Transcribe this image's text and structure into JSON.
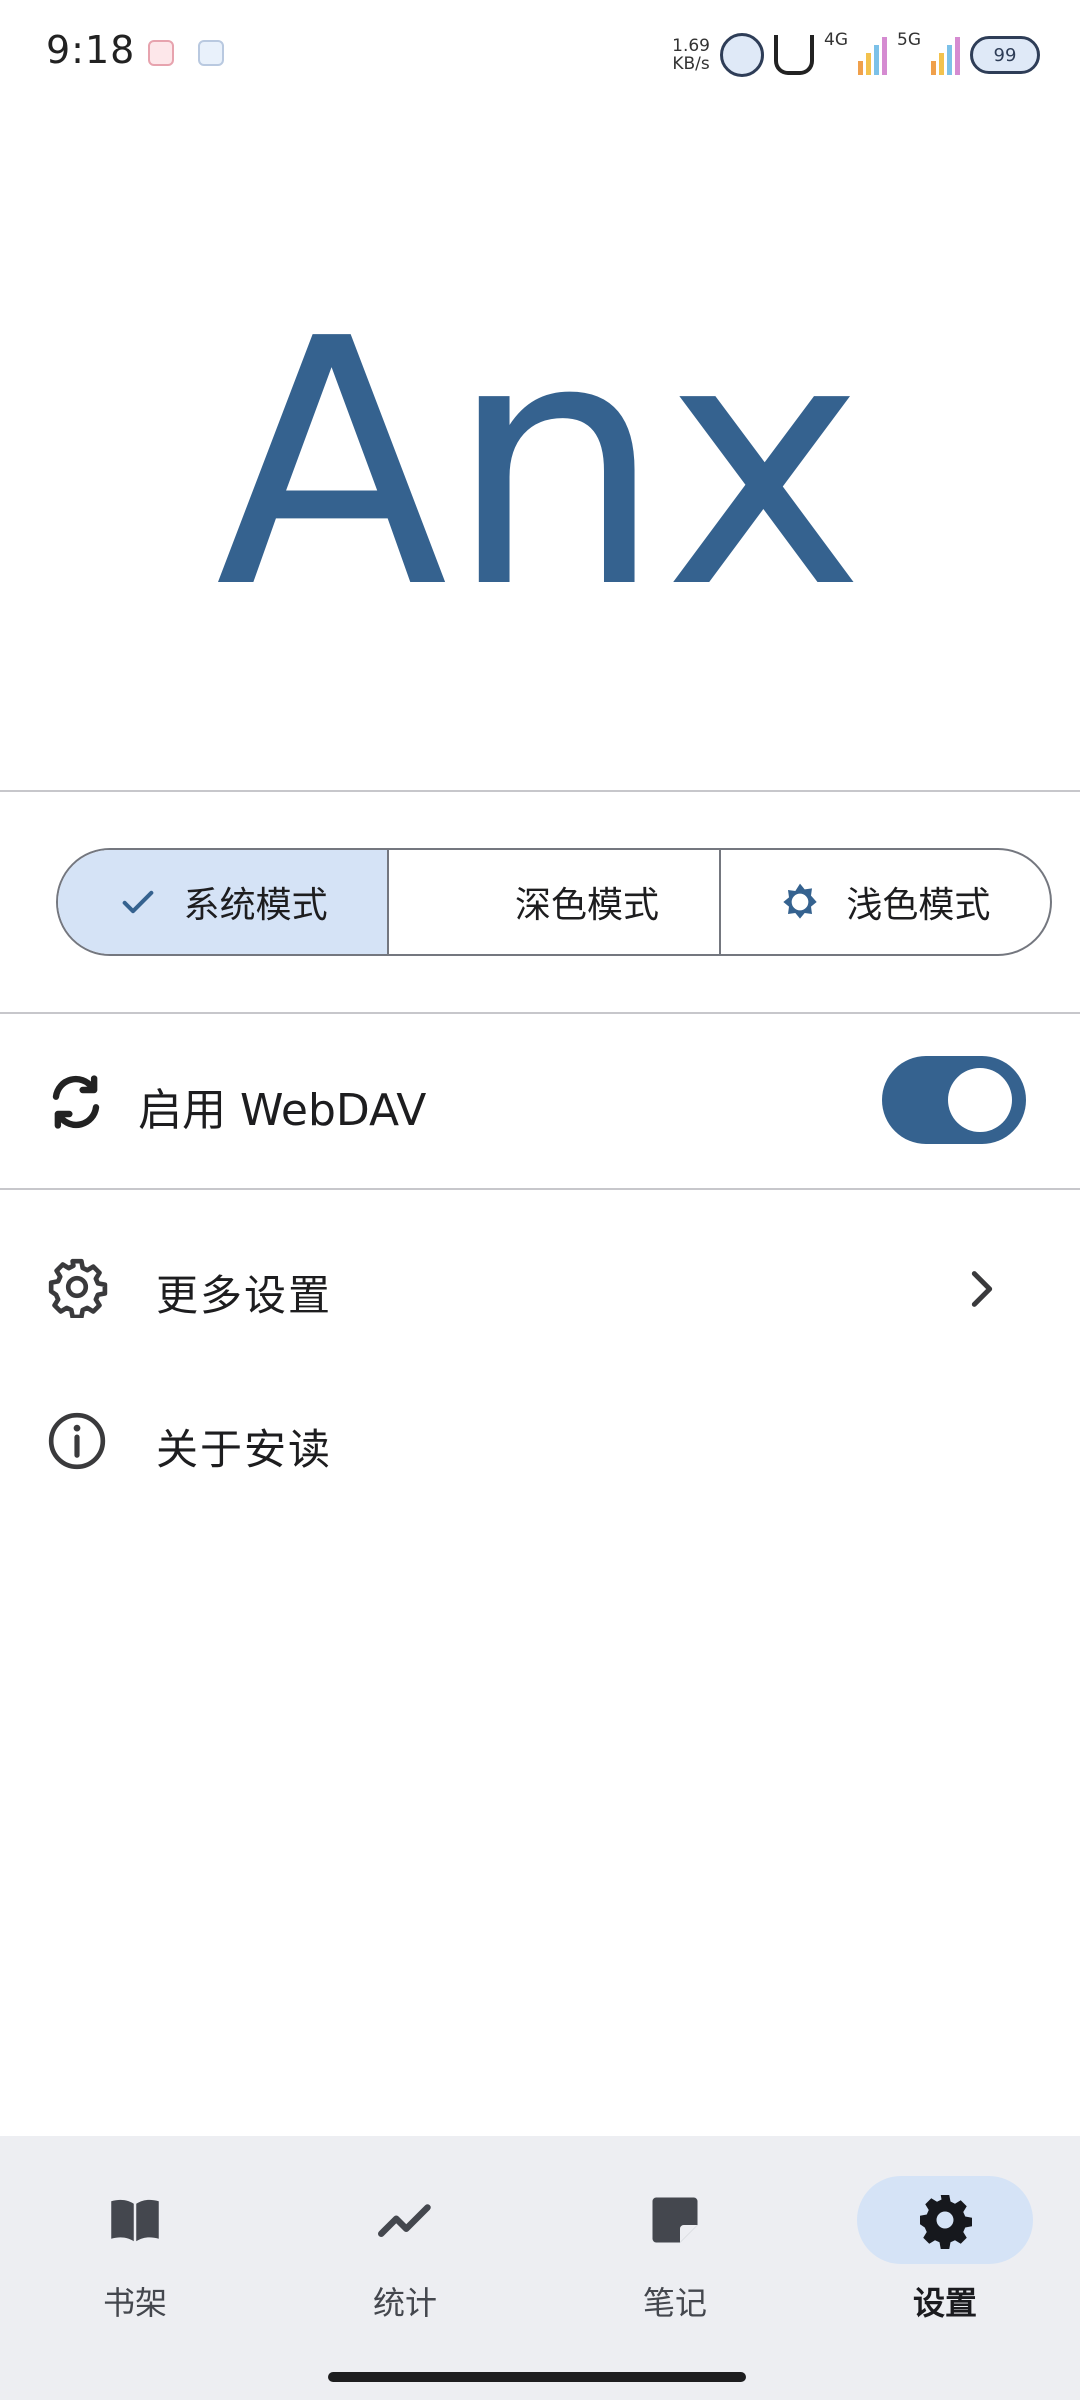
{
  "status_bar": {
    "time": "9:18",
    "net_speed_value": "1.69",
    "net_speed_unit": "KB/s",
    "network_1": "4G",
    "network_2": "5G",
    "battery": "99"
  },
  "logo": {
    "text": "Anx",
    "color": "#35628f"
  },
  "theme_modes": [
    {
      "label": "系统模式",
      "icon": "check-icon",
      "selected": true
    },
    {
      "label": "深色模式",
      "icon": "moon-icon",
      "selected": false
    },
    {
      "label": "浅色模式",
      "icon": "sun-icon",
      "selected": false
    }
  ],
  "webdav": {
    "label": "启用 WebDAV",
    "icon": "sync-icon",
    "enabled": true
  },
  "menu": [
    {
      "label": "更多设置",
      "icon": "gear-icon",
      "has_chevron": true
    },
    {
      "label": "关于安读",
      "icon": "info-icon",
      "has_chevron": false
    }
  ],
  "bottom_nav": [
    {
      "label": "书架",
      "icon": "book-icon",
      "active": false
    },
    {
      "label": "统计",
      "icon": "trend-icon",
      "active": false
    },
    {
      "label": "笔记",
      "icon": "note-icon",
      "active": false
    },
    {
      "label": "设置",
      "icon": "settings-icon",
      "active": true
    }
  ],
  "colors": {
    "accent": "#35628f",
    "selected_bg": "#d5e3f6",
    "nav_bg": "#edeef2"
  }
}
